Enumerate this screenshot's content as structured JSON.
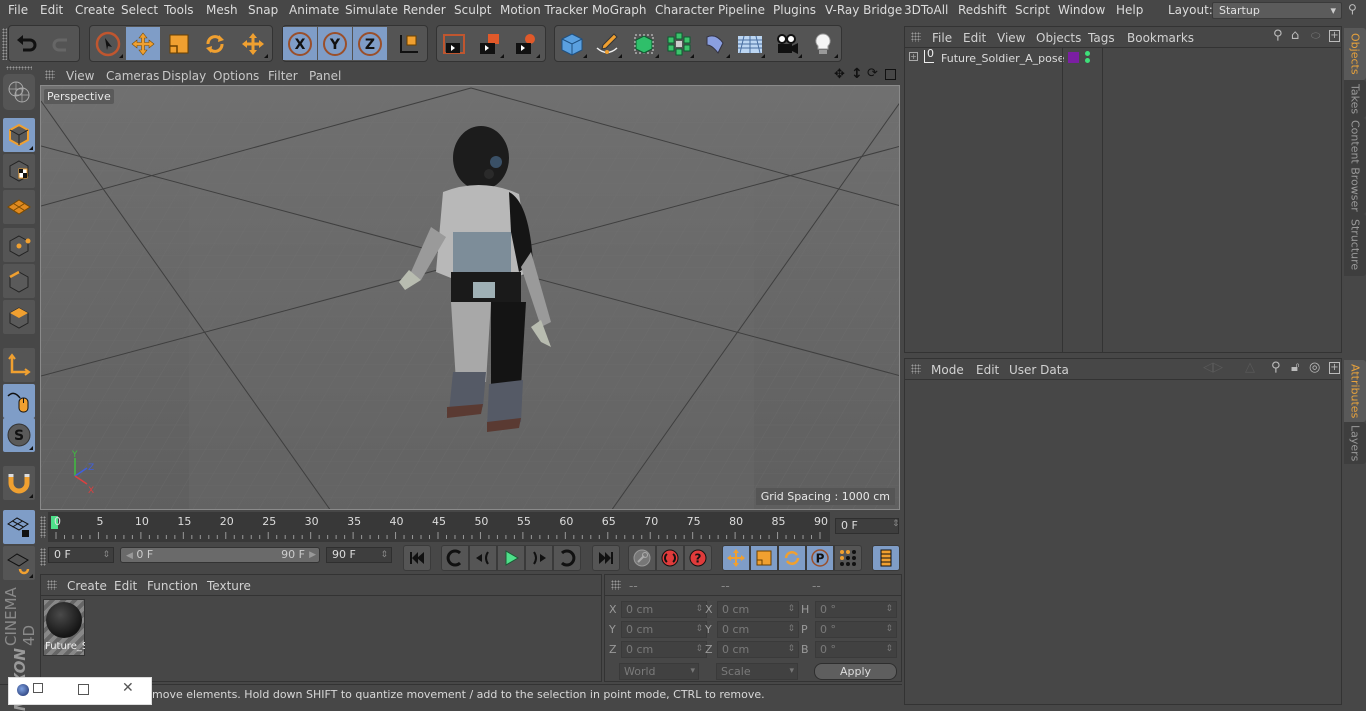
{
  "menubar": {
    "items": [
      "File",
      "Edit",
      "Create",
      "Select",
      "Tools",
      "Mesh",
      "Snap",
      "Animate",
      "Simulate",
      "Render",
      "Sculpt",
      "Motion Tracker",
      "MoGraph",
      "Character",
      "Pipeline",
      "Plugins",
      "V-Ray Bridge",
      "3DToAll",
      "Redshift",
      "Script",
      "Window",
      "Help"
    ],
    "layout_label": "Layout:",
    "layout_value": "Startup"
  },
  "toolbar": {
    "buttons": [
      {
        "icon": "undo-icon"
      },
      {
        "icon": "redo-icon"
      },
      {
        "icon": "live-select-icon"
      },
      {
        "icon": "move-icon",
        "active": true
      },
      {
        "icon": "scale-icon"
      },
      {
        "icon": "rotate-icon"
      },
      {
        "icon": "recent-tools-icon"
      },
      {
        "icon": "x-axis-icon",
        "active": true
      },
      {
        "icon": "y-axis-icon",
        "active": true
      },
      {
        "icon": "z-axis-icon",
        "active": true
      },
      {
        "icon": "coordinate-system-icon"
      },
      {
        "icon": "render-view-icon"
      },
      {
        "icon": "render-to-picture-viewer-icon"
      },
      {
        "icon": "render-settings-icon"
      },
      {
        "icon": "cube-icon"
      },
      {
        "icon": "pen-spline-icon"
      },
      {
        "icon": "subdivision-surface-icon"
      },
      {
        "icon": "cloner-icon"
      },
      {
        "icon": "deformer-bend-icon"
      },
      {
        "icon": "floor-icon"
      },
      {
        "icon": "camera-icon"
      },
      {
        "icon": "light-icon"
      }
    ]
  },
  "left_toolbar": {
    "buttons": [
      {
        "icon": "make-editable-icon"
      },
      {
        "icon": "model-mode-icon",
        "active": true
      },
      {
        "icon": "texture-mode-icon"
      },
      {
        "icon": "workplane-mode-icon"
      },
      {
        "icon": "points-mode-icon"
      },
      {
        "icon": "edges-mode-icon"
      },
      {
        "icon": "polygons-mode-icon"
      },
      {
        "icon": "axis-mode-icon"
      },
      {
        "icon": "tweak-mode-icon",
        "active": true
      },
      {
        "icon": "solo-mode-icon",
        "active": true
      },
      {
        "icon": "snap-magnet-icon"
      },
      {
        "icon": "workplane-lock-icon",
        "active": true
      },
      {
        "icon": "workplane-align-icon"
      }
    ],
    "brand_line1": "MAXON",
    "brand_line2": "CINEMA 4D"
  },
  "viewport": {
    "menu": [
      "View",
      "Cameras",
      "Display",
      "Options",
      "Filter",
      "Panel"
    ],
    "camera_label": "Perspective",
    "grid_spacing": "Grid Spacing : 1000 cm",
    "axis_labels": {
      "x": "X",
      "y": "Y",
      "z": "Z"
    },
    "nav_icons": [
      "pan-icon",
      "dolly-icon",
      "orbit-icon",
      "maximize-view-icon"
    ]
  },
  "timeline": {
    "ticks": [
      "0",
      "5",
      "10",
      "15",
      "20",
      "25",
      "30",
      "35",
      "40",
      "45",
      "50",
      "55",
      "60",
      "65",
      "70",
      "75",
      "80",
      "85",
      "90"
    ],
    "current_frame_marker": 0,
    "current_frame": "0 F"
  },
  "playback": {
    "start_field": "0 F",
    "range_start": "0 F",
    "range_end": "90 F",
    "end_field": "90 F",
    "buttons": [
      "go-to-start-icon",
      "previous-key-icon",
      "previous-frame-icon",
      "play-icon",
      "next-frame-icon",
      "next-key-icon",
      "go-to-end-icon",
      "record-keyframe-icon",
      "autokey-icon",
      "keyframe-selection-icon",
      "key-position-icon",
      "key-scale-icon",
      "key-rotation-icon",
      "key-parameter-icon",
      "key-pla-icon",
      "timeline-window-icon"
    ]
  },
  "material_manager": {
    "menu": [
      "Create",
      "Edit",
      "Function",
      "Texture"
    ],
    "materials": [
      {
        "name": "Future_S"
      }
    ]
  },
  "coordinates": {
    "headers": [
      "--",
      "--",
      "--"
    ],
    "rows": [
      {
        "l1": "X",
        "v1": "0 cm",
        "l2": "X",
        "v2": "0 cm",
        "l3": "H",
        "v3": "0 °"
      },
      {
        "l1": "Y",
        "v1": "0 cm",
        "l2": "Y",
        "v2": "0 cm",
        "l3": "P",
        "v3": "0 °"
      },
      {
        "l1": "Z",
        "v1": "0 cm",
        "l2": "Z",
        "v2": "0 cm",
        "l3": "B",
        "v3": "0 °"
      }
    ],
    "space_select": "World",
    "mode_select": "Scale",
    "apply_label": "Apply"
  },
  "status": {
    "text": "move elements. Hold down SHIFT to quantize movement / add to the selection in point mode, CTRL to remove."
  },
  "object_manager": {
    "menu": [
      "File",
      "Edit",
      "View",
      "Objects",
      "Tags",
      "Bookmarks"
    ],
    "objects": [
      {
        "name": "Future_Soldier_A_pose",
        "layer_color": "#7b1fa2"
      }
    ]
  },
  "attribute_manager": {
    "menu": [
      "Mode",
      "Edit",
      "User Data"
    ]
  },
  "side_tabs": {
    "top": [
      {
        "label": "Objects",
        "active": true
      },
      {
        "label": "Takes"
      },
      {
        "label": "Content Browser"
      },
      {
        "label": "Structure"
      }
    ],
    "bottom": [
      {
        "label": "Attributes",
        "active": true
      },
      {
        "label": "Layers"
      }
    ]
  },
  "colors": {
    "accent_active": "#7f9dc7",
    "tool_orange": "#f0a030",
    "tab_active_text": "#e8a23c",
    "play_green": "#4ee08a"
  }
}
